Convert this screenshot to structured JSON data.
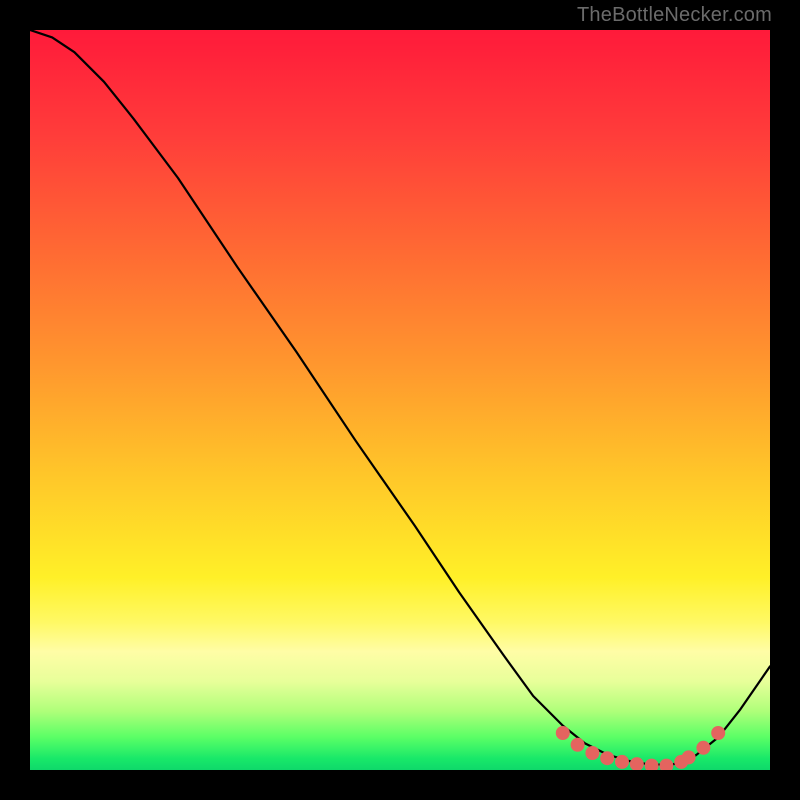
{
  "watermark": "TheBottleNecker.com",
  "colors": {
    "gradient_stops": [
      {
        "offset": 0.0,
        "color": "#ff1a3a"
      },
      {
        "offset": 0.14,
        "color": "#ff3c3a"
      },
      {
        "offset": 0.3,
        "color": "#ff6a33"
      },
      {
        "offset": 0.45,
        "color": "#ff962e"
      },
      {
        "offset": 0.6,
        "color": "#ffc629"
      },
      {
        "offset": 0.74,
        "color": "#fff028"
      },
      {
        "offset": 0.8,
        "color": "#fff964"
      },
      {
        "offset": 0.84,
        "color": "#fffda6"
      },
      {
        "offset": 0.88,
        "color": "#e8ff9a"
      },
      {
        "offset": 0.92,
        "color": "#b0ff7a"
      },
      {
        "offset": 0.955,
        "color": "#5cff66"
      },
      {
        "offset": 0.985,
        "color": "#18e869"
      },
      {
        "offset": 1.0,
        "color": "#0fd86a"
      }
    ],
    "curve": "#000000",
    "marker": "#e4645f",
    "axes": null
  },
  "chart_data": {
    "type": "line",
    "title": "",
    "xlabel": "",
    "ylabel": "",
    "xlim": [
      0,
      100
    ],
    "ylim": [
      0,
      100
    ],
    "series": [
      {
        "name": "curve",
        "x": [
          0,
          3,
          6,
          10,
          14,
          20,
          28,
          36,
          44,
          52,
          58,
          64,
          68,
          72,
          75,
          78,
          81,
          84,
          87,
          90,
          93,
          96,
          100
        ],
        "y": [
          100,
          99,
          97,
          93,
          88,
          80,
          68,
          56.5,
          44.5,
          33,
          24,
          15.5,
          10,
          6,
          3.6,
          2.1,
          1.2,
          0.7,
          0.8,
          2.0,
          4.4,
          8.2,
          14
        ]
      }
    ],
    "markers": {
      "name": "bottom-cluster",
      "x": [
        72,
        74,
        76,
        78,
        80,
        82,
        84,
        86,
        88,
        89,
        91,
        93
      ],
      "y": [
        5.0,
        3.4,
        2.3,
        1.6,
        1.1,
        0.8,
        0.6,
        0.6,
        1.1,
        1.7,
        3.0,
        5.0
      ]
    }
  }
}
